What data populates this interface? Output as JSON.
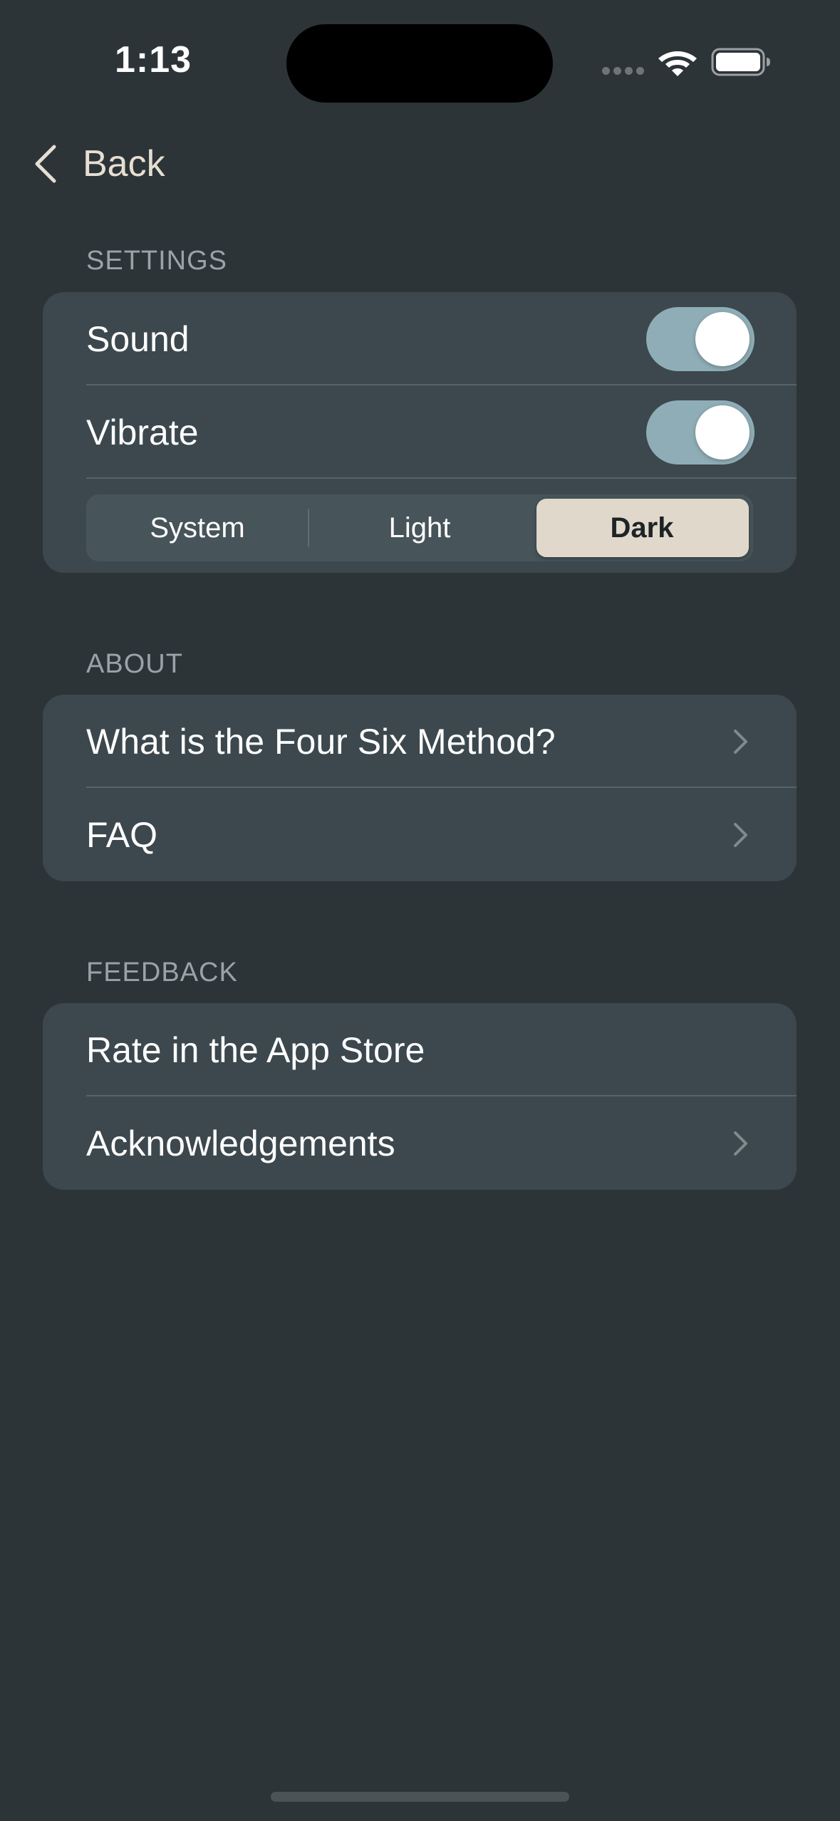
{
  "status_bar": {
    "time": "1:13",
    "wifi_icon": "wifi-icon",
    "battery_icon": "battery-icon"
  },
  "nav": {
    "back_label": "Back",
    "back_icon": "chevron-left-icon"
  },
  "settings": {
    "header": "SETTINGS",
    "sound_label": "Sound",
    "sound_on": true,
    "vibrate_label": "Vibrate",
    "vibrate_on": true,
    "appearance": {
      "options": [
        "System",
        "Light",
        "Dark"
      ],
      "selected": "Dark"
    }
  },
  "about": {
    "header": "ABOUT",
    "items": [
      {
        "label": "What is the Four Six Method?",
        "chevron": true
      },
      {
        "label": "FAQ",
        "chevron": true
      }
    ]
  },
  "feedback": {
    "header": "FEEDBACK",
    "items": [
      {
        "label": "Rate in the App Store",
        "chevron": false
      },
      {
        "label": "Acknowledgements",
        "chevron": true
      }
    ]
  },
  "colors": {
    "background": "#2d3438",
    "card": "#3c484d",
    "toggle_on": "#8fadb6",
    "segment_selected": "#e0d8cb",
    "accent_text": "#e6dfd2"
  }
}
